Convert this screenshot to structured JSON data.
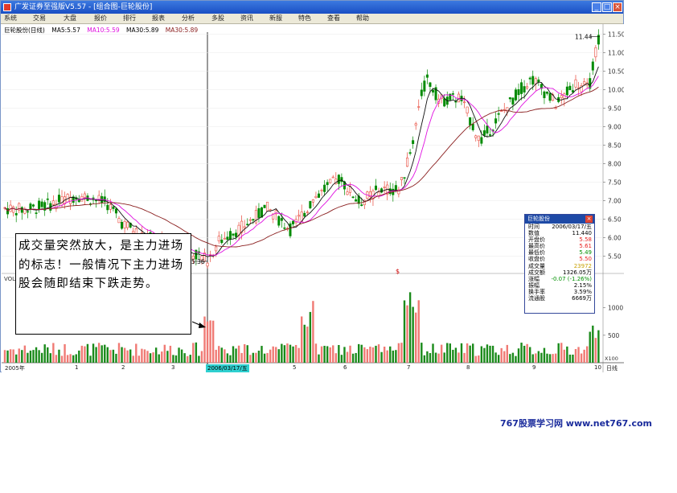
{
  "window": {
    "title": "广发证券至强版V5.57 - [组合图-巨轮股份]",
    "btn_min": "_",
    "btn_max": "□",
    "btn_close": "×"
  },
  "menu": [
    "系统",
    "交易",
    "大盘",
    "报价",
    "排行",
    "报表",
    "分析",
    "多股",
    "资讯",
    "新服",
    "特色",
    "查看",
    "帮助"
  ],
  "chart": {
    "stock_title": "巨轮股份(日线)",
    "ma5": "MA5:5.57",
    "ma10": "MA10:5.59",
    "ma30a": "MA30:5.89",
    "ma30b": "MA30:5.89",
    "high_label": "11.44",
    "low_label": "5.36",
    "vol_label": "VOL",
    "price_ticks": [
      "11.50",
      "11.00",
      "10.50",
      "10.00",
      "9.50",
      "9.00",
      "8.50",
      "8.00",
      "7.50",
      "7.00",
      "6.50",
      "6.00",
      "5.50"
    ],
    "vol_ticks": [
      "1000",
      "500"
    ],
    "vol_unit": "X100",
    "period": "日线",
    "dates": [
      "2005年",
      "1",
      "2",
      "3",
      "2006/03/17/五",
      "5",
      "6",
      "7",
      "8",
      "9",
      "10"
    ],
    "dollar_mark": "$"
  },
  "chart_data": {
    "type": "candlestick",
    "title": "巨轮股份(日线)",
    "ylim": [
      5.25,
      11.6
    ],
    "series": [
      {
        "name": "MA5",
        "value": 5.57
      },
      {
        "name": "MA10",
        "value": 5.59
      },
      {
        "name": "MA30",
        "value": 5.89
      }
    ],
    "annotations": {
      "max_price": 11.44,
      "min_price": 5.36
    }
  },
  "callout": {
    "text": "成交量突然放大，是主力进场的标志！一般情况下主力进场股会随即结束下跌走势。"
  },
  "info_panel": {
    "title": "巨轮股份",
    "rows": [
      {
        "label": "时间",
        "value": "2006/03/17/五"
      },
      {
        "label": "数值",
        "value": "11.440"
      },
      {
        "label": "开盘价",
        "value": "5.58"
      },
      {
        "label": "最高价",
        "value": "5.61"
      },
      {
        "label": "最低价",
        "value": "5.49"
      },
      {
        "label": "收盘价",
        "value": "5.50"
      },
      {
        "label": "成交量",
        "value": "23972"
      },
      {
        "label": "成交额",
        "value": "1326.05万"
      },
      {
        "label": "涨幅",
        "value": "-0.07 (-1.26%)"
      },
      {
        "label": "振幅",
        "value": "2.15%"
      },
      {
        "label": "换手率",
        "value": "3.59%"
      },
      {
        "label": "流通股",
        "value": "6669万"
      }
    ],
    "colors": {
      "up": "#e82020",
      "down": "#009000",
      "neutral": "#000000",
      "vol": "#c8a000"
    }
  },
  "footer": {
    "text": "767股票学习网 www.net767.com"
  }
}
